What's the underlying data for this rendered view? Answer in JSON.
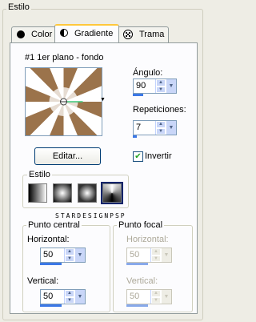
{
  "dialog": {
    "group_title": "Estilo"
  },
  "tabs": [
    {
      "label": "Color",
      "icon": "solid-dot-icon"
    },
    {
      "label": "Gradiente",
      "icon": "half-circle-icon"
    },
    {
      "label": "Trama",
      "icon": "pattern-icon"
    }
  ],
  "gradient": {
    "name": "#1 1er plano - fondo",
    "colors": {
      "dark": "#8a5a2b",
      "light": "#ffffff"
    }
  },
  "angle": {
    "label": "Ángulo:",
    "value": "90",
    "fill": 0.25
  },
  "repeats": {
    "label": "Repeticiones:",
    "value": "7",
    "fill": 0.07
  },
  "edit_button": "Editar...",
  "invert": {
    "label": "Invertir",
    "checked": true
  },
  "style_group": {
    "label": "Estilo",
    "selected": 3
  },
  "watermark": "STARDESIGNPSP",
  "center_point": {
    "title": "Punto central",
    "horizontal": {
      "label": "Horizontal:",
      "value": "50"
    },
    "vertical": {
      "label": "Vertical:",
      "value": "50"
    }
  },
  "focal_point": {
    "title": "Punto focal",
    "horizontal": {
      "label": "Horizontal:",
      "value": "50"
    },
    "vertical": {
      "label": "Vertical:",
      "value": "50"
    }
  }
}
